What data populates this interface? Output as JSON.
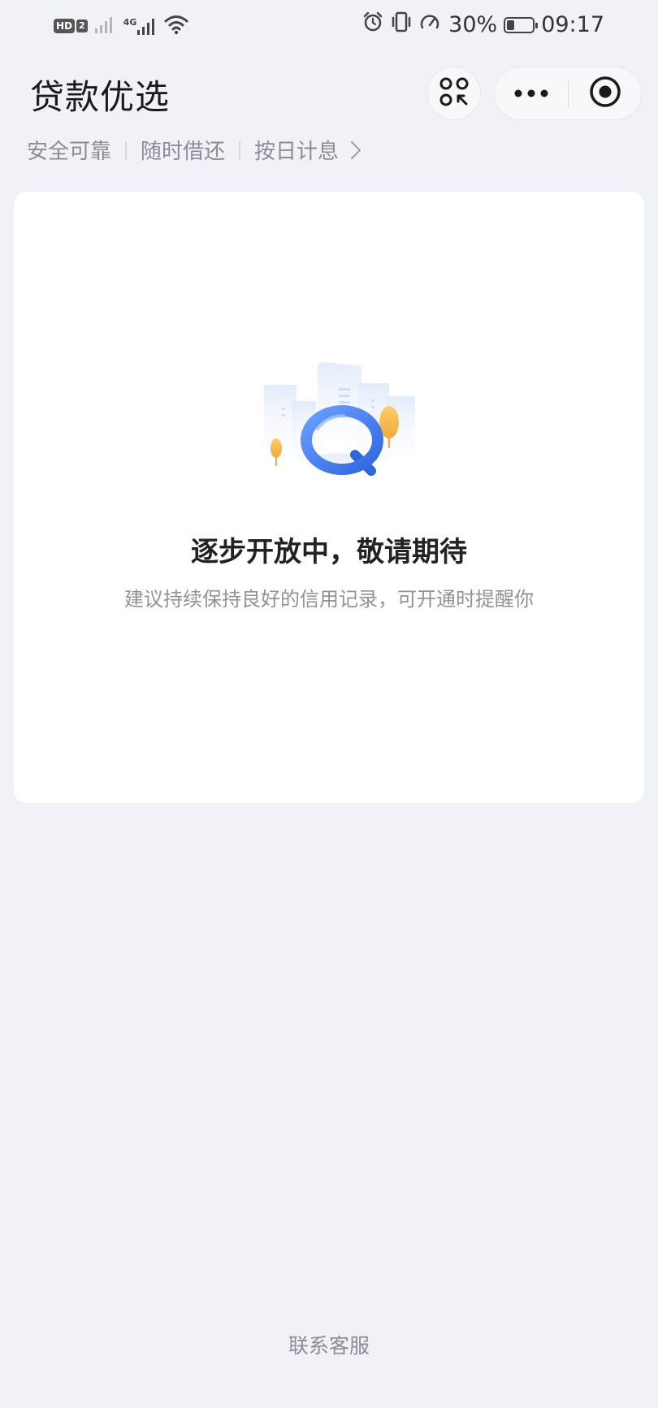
{
  "status_bar": {
    "hd_label": "HD",
    "sim_label": "2",
    "network_label": "4G",
    "battery_percent": "30%",
    "battery_level": 0.3,
    "time": "09:17",
    "icons": [
      "hd-icon",
      "signal-icon",
      "4g-signal-icon",
      "wifi-icon",
      "alarm-icon",
      "vibrate-icon",
      "speed-icon",
      "battery-icon"
    ]
  },
  "header": {
    "title": "贷款优选",
    "capsule_icons": [
      "mini-program-switch-icon",
      "more-icon",
      "close-target-icon"
    ]
  },
  "tags": {
    "items": [
      "安全可靠",
      "随时借还",
      "按日计息"
    ],
    "chevron_icon": "chevron-right-icon"
  },
  "empty_state": {
    "illustration": "magnifier-city-illustration",
    "title": "逐步开放中，敬请期待",
    "description": "建议持续保持良好的信用记录，可开通时提醒你"
  },
  "footer": {
    "contact_label": "联系客服"
  },
  "colors": {
    "background": "#eff2f7",
    "card": "#ffffff",
    "accent_blue": "#3a78f2",
    "tree_yellow": "#f7c257",
    "muted_text": "#8a8d93"
  }
}
